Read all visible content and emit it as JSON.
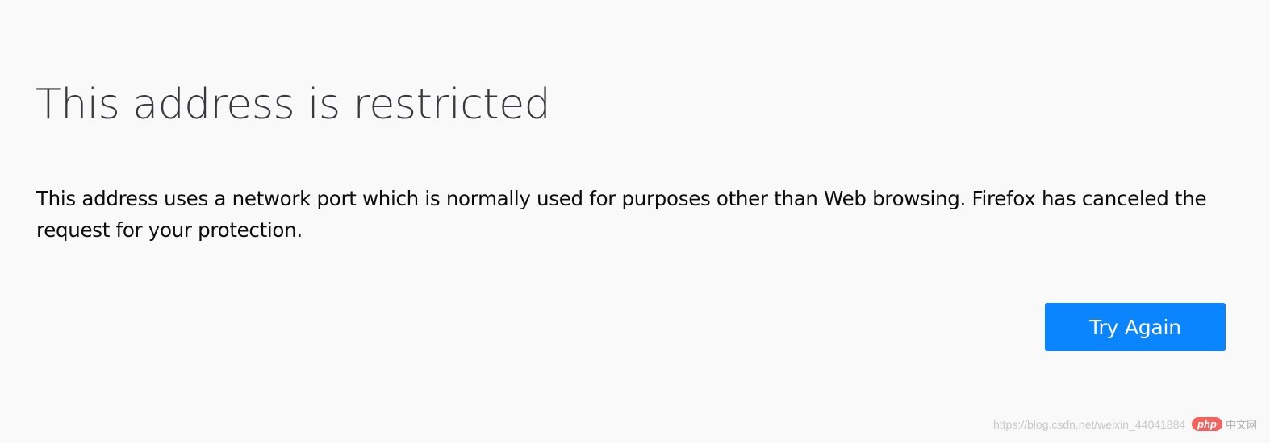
{
  "error_page": {
    "title": "This address is restricted",
    "description": "This address uses a network port which is normally used for purposes other than Web browsing. Firefox has canceled the request for your protection.",
    "try_again_label": "Try Again"
  },
  "watermark": {
    "url": "https://blog.csdn.net/weixin_44041884",
    "badge": "php",
    "cn_text": "中文网"
  },
  "colors": {
    "background": "#f9f9fa",
    "button": "#0a84ff",
    "title_text": "#38383d"
  }
}
